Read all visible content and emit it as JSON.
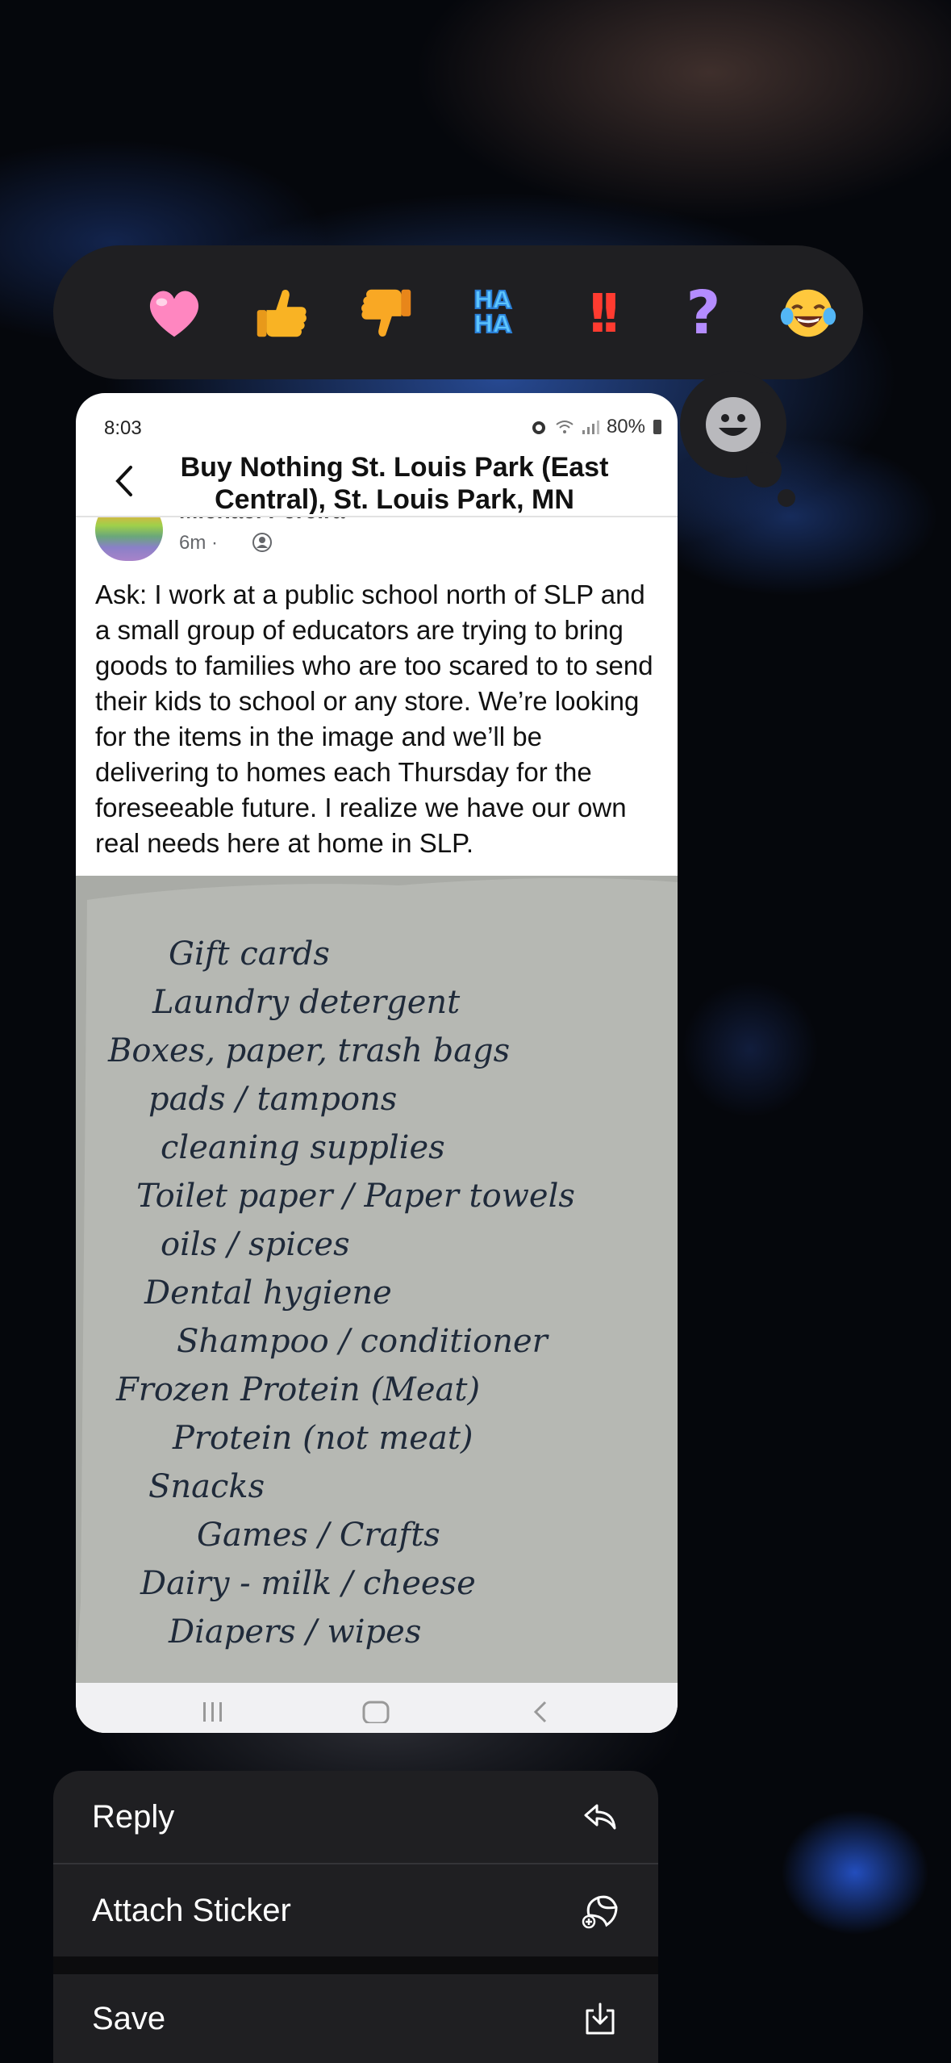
{
  "reactions": [
    {
      "name": "heart-reaction",
      "glyph": "heart"
    },
    {
      "name": "thumbs-up-reaction",
      "glyph": "thumbs-up"
    },
    {
      "name": "thumbs-down-reaction",
      "glyph": "thumbs-down"
    },
    {
      "name": "haha-reaction",
      "text_top": "HA",
      "text_bottom": "HA"
    },
    {
      "name": "exclamation-reaction",
      "text": "!!"
    },
    {
      "name": "question-reaction",
      "text": "?"
    },
    {
      "name": "laughing-reaction",
      "glyph": "tears-of-joy"
    },
    {
      "name": "heart-red-reaction",
      "glyph": "heart"
    }
  ],
  "colors": {
    "accent_heart": "#ff7fb6",
    "thumb": "#f9b324",
    "menu_bg": "#1f1f22",
    "card_bg": "#ffffff"
  },
  "screenshot": {
    "status_time": "8:03",
    "battery": "80%",
    "group_title": "Buy Nothing St. Louis Park (East Central), St. Louis Park, MN",
    "author": "Michael Pereira",
    "post_time": "6m ·",
    "post_text": "Ask: I work at a public school north of SLP and a small group of educators are trying to bring goods to families who are too scared to to send their kids to school or any store. We’re looking for the items in the image and we’ll be delivering to homes each Thursday for the foreseeable future. I realize we have our own real needs here at home in SLP.",
    "handwritten_list": [
      "Gift cards",
      "Laundry detergent",
      "Boxes, paper, trash bags",
      "pads / tampons",
      "cleaning supplies",
      "Toilet paper / Paper towels",
      "oils / spices",
      "Dental hygiene",
      "Shampoo / conditioner",
      "Frozen Protein (Meat)",
      "Protein (not meat)",
      "Snacks",
      "Games / Crafts",
      "Dairy - milk / cheese",
      "Diapers / wipes"
    ]
  },
  "menu": {
    "reply_label": "Reply",
    "attach_sticker_label": "Attach Sticker",
    "save_label": "Save"
  }
}
